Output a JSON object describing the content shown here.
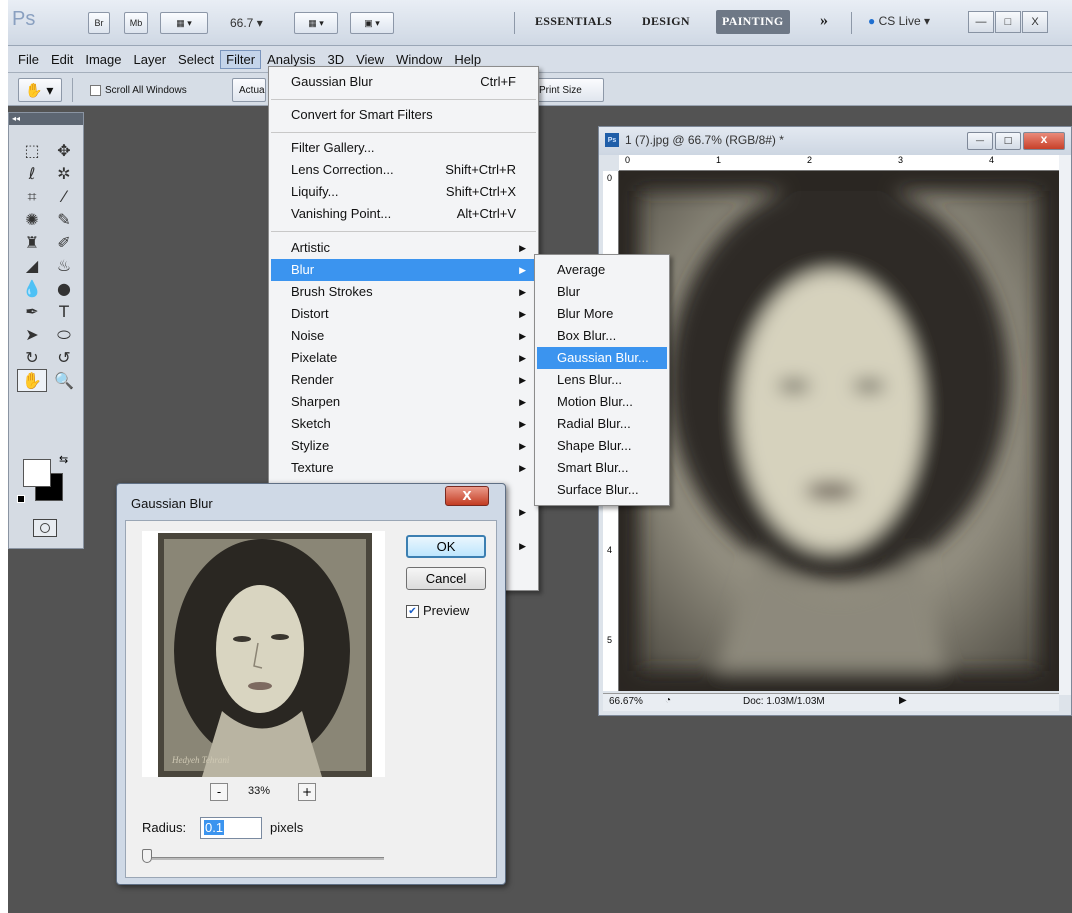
{
  "app": {
    "logo": "Ps",
    "bridge_btn": "Br",
    "minibridge_btn": "Mb",
    "zoom": "66.7",
    "workspaces": [
      "ESSENTIALS",
      "DESIGN",
      "PAINTING"
    ],
    "active_workspace": "PAINTING",
    "more": "»",
    "cs_live": "CS Live",
    "win_min": "—",
    "win_max": "□",
    "win_close": "X"
  },
  "menubar": [
    "File",
    "Edit",
    "Image",
    "Layer",
    "Select",
    "Filter",
    "Analysis",
    "3D",
    "View",
    "Window",
    "Help"
  ],
  "options": {
    "scroll_all": "Scroll All Windows",
    "scroll_all_checked": false,
    "actual": "Actua",
    "print_size": "Print Size"
  },
  "tools_icons": [
    "marquee-icon",
    "move-icon",
    "lasso-icon",
    "quick-select-icon",
    "crop-icon",
    "eyedropper-icon",
    "spot-heal-icon",
    "brush-icon",
    "stamp-icon",
    "history-brush-icon",
    "eraser-icon",
    "bucket-icon",
    "blur-tool-icon",
    "dodge-icon",
    "pen-icon",
    "type-icon",
    "path-select-icon",
    "ellipse-icon",
    "3d-rotate-icon",
    "3d-orbit-icon",
    "hand-icon",
    "zoom-icon"
  ],
  "filter_menu": {
    "last_filter": "Gaussian Blur",
    "last_filter_shortcut": "Ctrl+F",
    "convert": "Convert for Smart Filters",
    "gallery": "Filter Gallery...",
    "lens_correction": "Lens Correction...",
    "lens_correction_shortcut": "Shift+Ctrl+R",
    "liquify": "Liquify...",
    "liquify_shortcut": "Shift+Ctrl+X",
    "vanishing": "Vanishing Point...",
    "vanishing_shortcut": "Alt+Ctrl+V",
    "categories": [
      "Artistic",
      "Blur",
      "Brush Strokes",
      "Distort",
      "Noise",
      "Pixelate",
      "Render",
      "Sharpen",
      "Sketch",
      "Stylize",
      "Texture"
    ],
    "highlighted": "Blur"
  },
  "blur_submenu": {
    "items": [
      "Average",
      "Blur",
      "Blur More",
      "Box Blur...",
      "Gaussian Blur...",
      "Lens Blur...",
      "Motion Blur...",
      "Radial Blur...",
      "Shape Blur...",
      "Smart Blur...",
      "Surface Blur..."
    ],
    "highlighted": "Gaussian Blur..."
  },
  "document": {
    "icon": "Ps",
    "title": "1 (7).jpg @ 66.7% (RGB/8#) *",
    "ruler_h": [
      "0",
      "1",
      "2",
      "3",
      "4"
    ],
    "ruler_v": [
      "0",
      "4",
      "5"
    ],
    "zoom": "66.67%",
    "doc_size": "Doc: 1.03M/1.03M"
  },
  "dialog": {
    "title": "Gaussian Blur",
    "close": "X",
    "ok": "OK",
    "cancel": "Cancel",
    "preview_label": "Preview",
    "preview_checked": true,
    "zoom_out": "-",
    "zoom_in": "+",
    "zoom_pct": "33%",
    "radius_label": "Radius:",
    "radius_value": "0.1",
    "units": "pixels",
    "slider_value": 0.1
  },
  "colors": {
    "workspace_bg": "#535353",
    "menu_highlight": "#3b94ef",
    "chrome": "#d7dee8"
  }
}
